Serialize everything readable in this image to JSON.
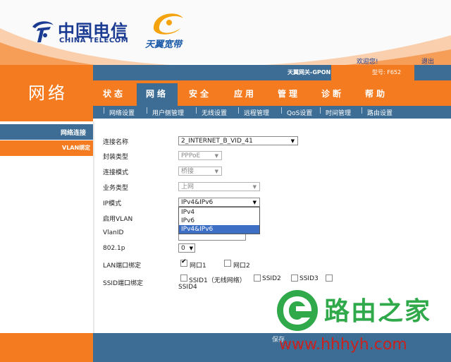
{
  "header": {
    "brand_cn": "中国电信",
    "brand_en": "CHINA TELECOM",
    "tianyi": "天翼宽带",
    "welcome": "欢迎您!",
    "logout": "退出"
  },
  "left_panel": {
    "title": "网络"
  },
  "model_bar": {
    "gateway": "天翼网关-GPON",
    "model": "型号: F652"
  },
  "nav": {
    "tabs": [
      {
        "label": "状态"
      },
      {
        "label": "网络",
        "active": true
      },
      {
        "label": "安全"
      },
      {
        "label": "应用"
      },
      {
        "label": "管理"
      },
      {
        "label": "诊断"
      },
      {
        "label": "帮助"
      }
    ]
  },
  "subnav": {
    "items": [
      "网络设置",
      "用户侧管理",
      "无线设置",
      "远程管理",
      "QoS设置",
      "时间管理",
      "路由设置"
    ]
  },
  "sidebar": {
    "items": [
      {
        "label": "网络连接"
      },
      {
        "label": "VLAN绑定"
      }
    ]
  },
  "form": {
    "conn_name": {
      "label": "连接名称",
      "value": "2_INTERNET_B_VID_41"
    },
    "encap": {
      "label": "封装类型",
      "value": "PPPoE"
    },
    "conn_mode": {
      "label": "连接模式",
      "value": "桥接"
    },
    "service": {
      "label": "业务类型",
      "value": "上网"
    },
    "ip_mode": {
      "label": "IP模式",
      "value": "IPv4&IPv6",
      "options": [
        "IPv4",
        "IPv6",
        "IPv4&IPv6"
      ]
    },
    "vlan": {
      "label": "启用VLAN"
    },
    "vlanid": {
      "label": "VlanID"
    },
    "dot1p": {
      "label": "802.1p",
      "value": "0"
    },
    "lan_bind": {
      "label": "LAN端口绑定",
      "ports": [
        {
          "label": "网口1",
          "checked": true
        },
        {
          "label": "网口2",
          "checked": false
        }
      ]
    },
    "ssid_bind": {
      "label": "SSID端口绑定",
      "ssids": [
        "SSID1（无线网络）",
        "SSID2",
        "SSID3",
        "SSID4"
      ]
    }
  },
  "footer": {
    "save": "保存"
  },
  "watermark": {
    "text": "路由之家",
    "url": "www.hhhyh.com"
  },
  "colors": {
    "orange": "#f47b20",
    "blue": "#3d6d94",
    "brand_blue": "#1a3b91"
  }
}
